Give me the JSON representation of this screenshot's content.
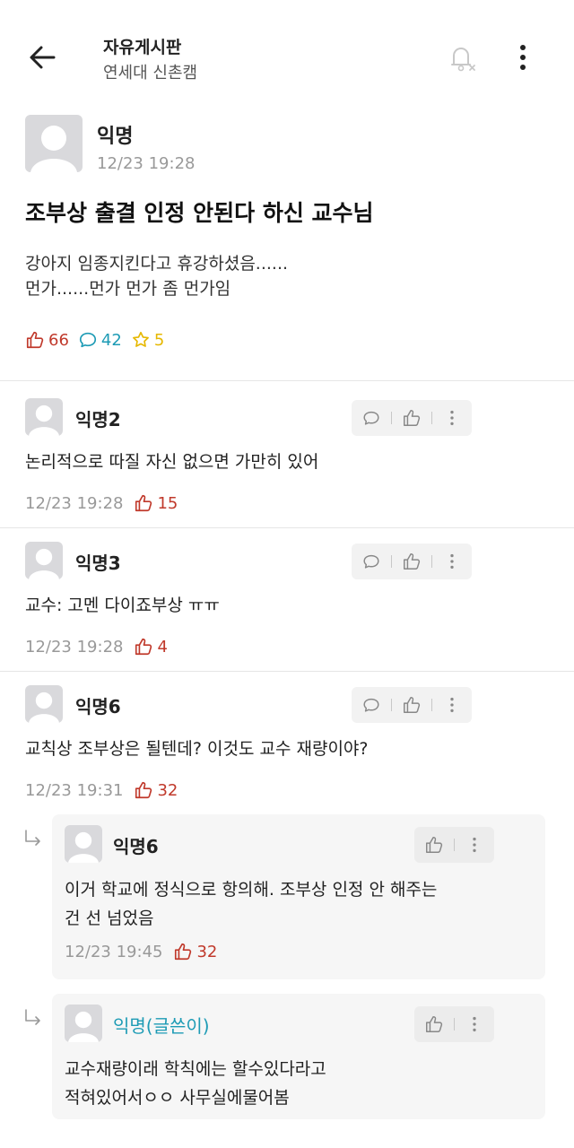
{
  "header": {
    "title": "자유게시판",
    "subtitle": "연세대 신촌캠",
    "back_icon": "arrow-left-icon",
    "notify_icon": "bell-off-icon",
    "more_icon": "more-vertical-icon"
  },
  "post": {
    "author": "익명",
    "time": "12/23 19:28",
    "title": "조부상 출결 인정 안된다 하신 교수님",
    "body_lines": [
      "강아지 임종지킨다고 휴강하셨음......",
      "먼가......먼가 먼가 좀 먼가임"
    ],
    "likes": "66",
    "comments": "42",
    "scraps": "5"
  },
  "comments": [
    {
      "author": "익명2",
      "text": "논리적으로 따질 자신 없으면 가만히 있어",
      "time": "12/23 19:28",
      "likes": "15"
    },
    {
      "author": "익명3",
      "text": "교수: 고멘 다이죠부상 ㅠㅠ",
      "time": "12/23 19:28",
      "likes": "4"
    },
    {
      "author": "익명6",
      "text": "교칙상 조부상은 될텐데? 이것도 교수 재량이야?",
      "time": "12/23 19:31",
      "likes": "32"
    }
  ],
  "replies": [
    {
      "author": "익명6",
      "text_lines": [
        "이거 학교에 정식으로 항의해. 조부상 인정 안 해주는",
        "건 선 넘었음"
      ],
      "time": "12/23 19:45",
      "likes": "32"
    },
    {
      "author": "익명(글쓴이)",
      "text_lines": [
        "교수재량이래 학칙에는 할수있다라고",
        "적혀있어서ㅇㅇ 사무실에물어봄"
      ]
    }
  ],
  "colors": {
    "like": "#c0392b",
    "comment": "#1d9bb5",
    "scrap": "#e6b800",
    "writer": "#1d9bb5"
  }
}
